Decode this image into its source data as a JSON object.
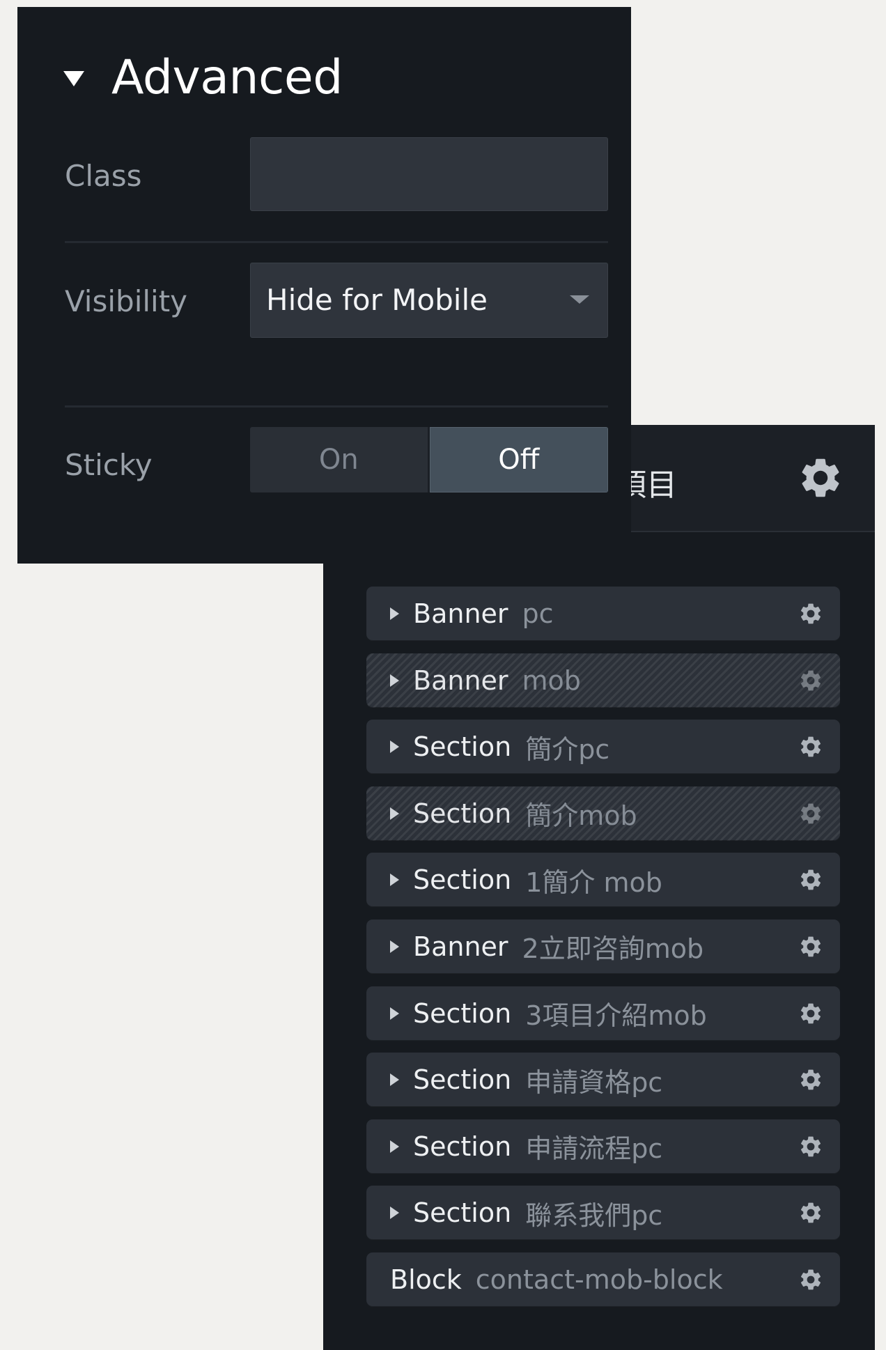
{
  "advanced": {
    "title": "Advanced",
    "class_label": "Class",
    "class_value": "",
    "visibility_label": "Visibility",
    "visibility_value": "Hide for Mobile",
    "sticky_label": "Sticky",
    "sticky_on": "On",
    "sticky_off": "Off",
    "sticky_selected": "Off"
  },
  "navigator": {
    "title_partial": "項目",
    "items": [
      {
        "type": "Banner",
        "name": "pc",
        "hidden": false,
        "expandable": true
      },
      {
        "type": "Banner",
        "name": "mob",
        "hidden": true,
        "expandable": true
      },
      {
        "type": "Section",
        "name": "簡介pc",
        "hidden": false,
        "expandable": true
      },
      {
        "type": "Section",
        "name": "簡介mob",
        "hidden": true,
        "expandable": true
      },
      {
        "type": "Section",
        "name": "1簡介 mob",
        "hidden": false,
        "expandable": true
      },
      {
        "type": "Banner",
        "name": "2立即咨詢mob",
        "hidden": false,
        "expandable": true
      },
      {
        "type": "Section",
        "name": "3項目介紹mob",
        "hidden": false,
        "expandable": true
      },
      {
        "type": "Section",
        "name": "申請資格pc",
        "hidden": false,
        "expandable": true
      },
      {
        "type": "Section",
        "name": "申請流程pc",
        "hidden": false,
        "expandable": true
      },
      {
        "type": "Section",
        "name": "聯系我們pc",
        "hidden": false,
        "expandable": true
      },
      {
        "type": "Block",
        "name": "contact-mob-block",
        "hidden": false,
        "expandable": false
      }
    ]
  },
  "colors": {
    "panel_bg": "#161a1f",
    "item_bg": "#2c3139",
    "toggle_active": "#44505b"
  }
}
